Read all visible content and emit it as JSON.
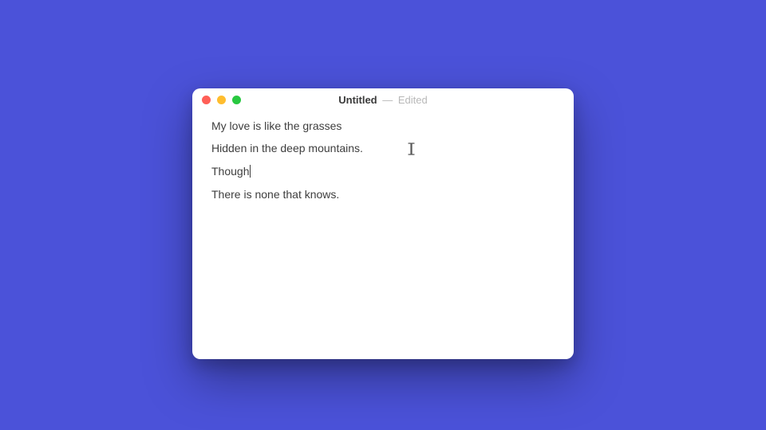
{
  "window": {
    "doc_title": "Untitled",
    "dash": "—",
    "state": "Edited"
  },
  "editor": {
    "lines": [
      "My love is like the grasses",
      "Hidden in the deep mountains.",
      "Though",
      "There is none that knows."
    ],
    "caret_after_line_index": 2
  },
  "colors": {
    "background": "#4B52D9",
    "window_bg": "#ffffff",
    "traffic_close": "#FF5F57",
    "traffic_min": "#FFBD2E",
    "traffic_zoom": "#28C840",
    "text": "#3e3e3e",
    "title_muted": "#b8b8b8"
  }
}
